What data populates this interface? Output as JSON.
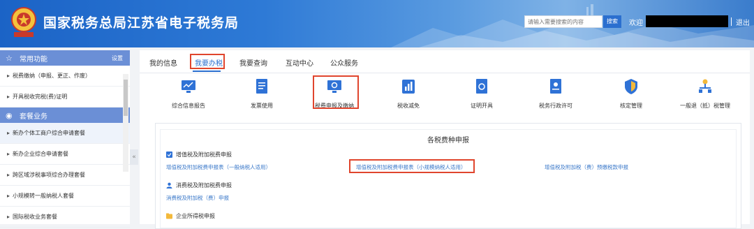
{
  "header": {
    "title": "国家税务总局江苏省电子税务局",
    "search_placeholder": "请输入需要搜索的内容",
    "search_button": "搜索",
    "welcome": "欢迎",
    "logout": "退出"
  },
  "sidebar": {
    "common_header": "常用功能",
    "common_settings": "设置",
    "common_items": [
      "税费缴纳（申报、更正、作废）",
      "开具税收完税(费)证明"
    ],
    "package_header": "套餐业务",
    "package_items": [
      "新办个体工商户综合申请套餐",
      "新办企业综合申请套餐",
      "跨区域涉税事项综合办理套餐",
      "小规模转一般纳税人套餐",
      "国际税收业务套餐"
    ],
    "collapse": "«"
  },
  "tabs": [
    "我的信息",
    "我要办税",
    "我要查询",
    "互动中心",
    "公众服务"
  ],
  "functions": [
    "综合信息报告",
    "发票使用",
    "税费申报及缴纳",
    "税收减免",
    "证明开具",
    "税务行政许可",
    "核定管理",
    "一般退（抵）税管理"
  ],
  "panel": {
    "title": "各税费种申报",
    "sections": [
      {
        "title": "增值税及附加税费申报",
        "links": [
          "增值税及附加税费申报表（一般纳税人适用）",
          "增值税及附加税费申报表（小规模纳税人适用）",
          "增值税及附加税（费）预缴税款申报"
        ]
      },
      {
        "title": "消费税及附加税费申报",
        "links": [
          "消费税及附加税（费）申报"
        ]
      },
      {
        "title": "企业所得税申报",
        "links": []
      }
    ]
  },
  "colors": {
    "header_blue": "#2b6fcf",
    "sidebar_header": "#6b8fd6",
    "highlight_red": "#e0452d",
    "link_blue": "#3a78c9",
    "icon_blue": "#2f72d6"
  }
}
